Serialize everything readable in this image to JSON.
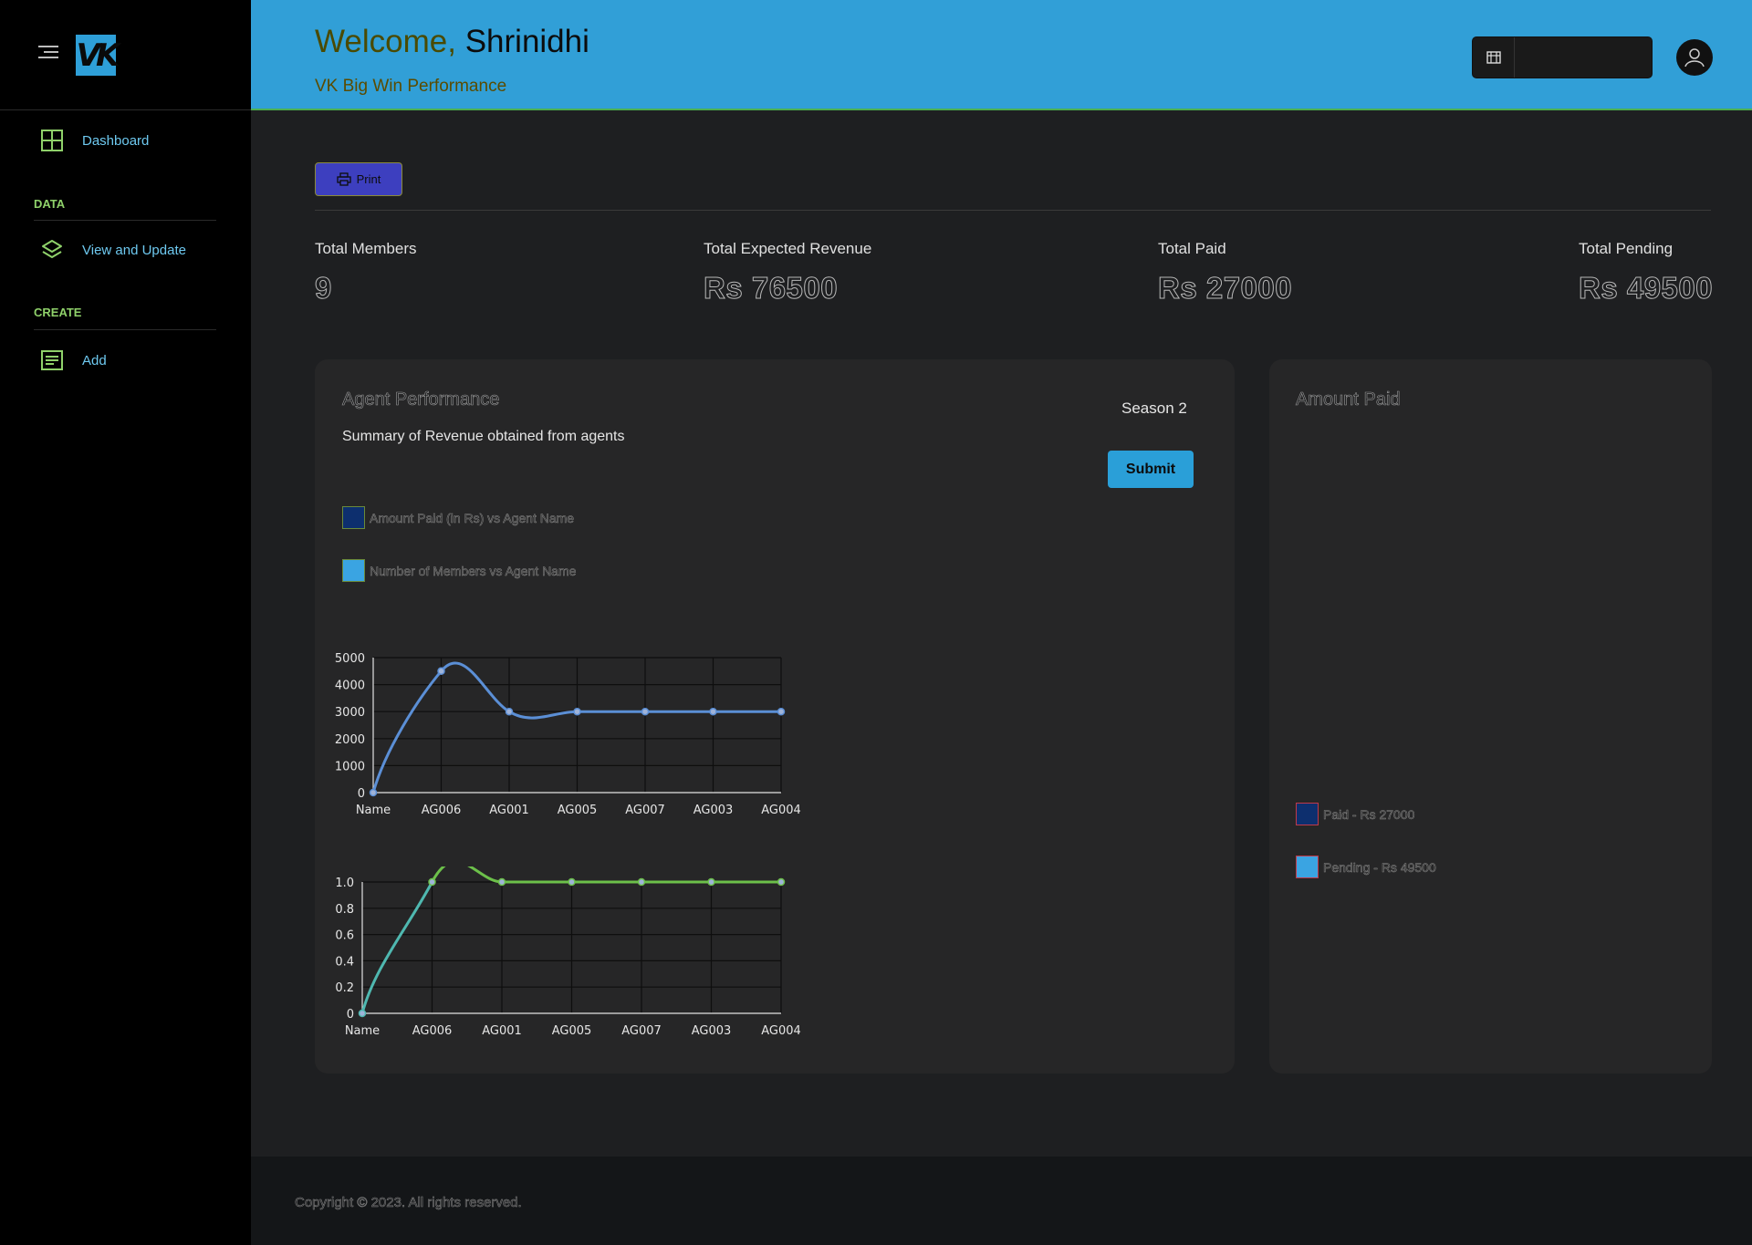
{
  "sidebar": {
    "items": [
      {
        "label": "Dashboard",
        "icon": "grid-icon"
      },
      {
        "label": "View and Update",
        "icon": "layers-icon"
      },
      {
        "label": "Add",
        "icon": "form-icon"
      }
    ],
    "sections": {
      "data": "DATA",
      "create": "CREATE"
    }
  },
  "header": {
    "welcome_prefix": "Welcome,",
    "user_name": "Shrinidhi",
    "subtitle": "VK Big Win Performance",
    "search_placeholder": ""
  },
  "toolbar": {
    "print_label": "Print"
  },
  "stats": [
    {
      "label": "Total Members",
      "value": "9"
    },
    {
      "label": "Total Expected Revenue",
      "value": "Rs 76500"
    },
    {
      "label": "Total Paid",
      "value": "Rs 27000"
    },
    {
      "label": "Total Pending",
      "value": "Rs 49500"
    }
  ],
  "agent_card": {
    "title": "Agent Performance",
    "subtitle": "Summary of Revenue obtained from agents",
    "season": "Season 2",
    "submit_label": "Submit",
    "legend": [
      {
        "label": "Amount Paid (in Rs) vs Agent Name",
        "color": "#0d2f6e"
      },
      {
        "label": "Number of Members vs Agent Name",
        "color": "#3aa4e2"
      }
    ]
  },
  "amount_card": {
    "title": "Amount Paid",
    "legend": [
      {
        "label": "Paid - Rs 27000",
        "color": "#0d2f6e"
      },
      {
        "label": "Pending - Rs 49500",
        "color": "#3aa4e2"
      }
    ]
  },
  "chart_data": [
    {
      "type": "line",
      "categories": [
        "Name",
        "AG006",
        "AG001",
        "AG005",
        "AG007",
        "AG003",
        "AG004"
      ],
      "values": [
        0,
        4500,
        3000,
        3000,
        3000,
        3000,
        3000
      ],
      "ylim": [
        0,
        5000
      ],
      "yticks": [
        0,
        1000,
        2000,
        3000,
        4000,
        5000
      ],
      "line_color": "#5b8fd6",
      "grid": true
    },
    {
      "type": "line",
      "categories": [
        "Name",
        "AG006",
        "AG001",
        "AG005",
        "AG007",
        "AG003",
        "AG004"
      ],
      "values": [
        0,
        1,
        1,
        1,
        1,
        1,
        1
      ],
      "ylim": [
        0,
        1
      ],
      "yticks": [
        "0",
        "0.2",
        "0.4",
        "0.6",
        "0.8",
        "1.0"
      ],
      "line_color": "#4fb8b0",
      "line_color_flat": "#6cc04a",
      "grid": true
    }
  ],
  "footer": {
    "copyright": "Copyright © 2023. All rights reserved."
  },
  "colors": {
    "accent": "#319fd7",
    "green": "#8fd16a",
    "print": "#3d3fbf"
  }
}
